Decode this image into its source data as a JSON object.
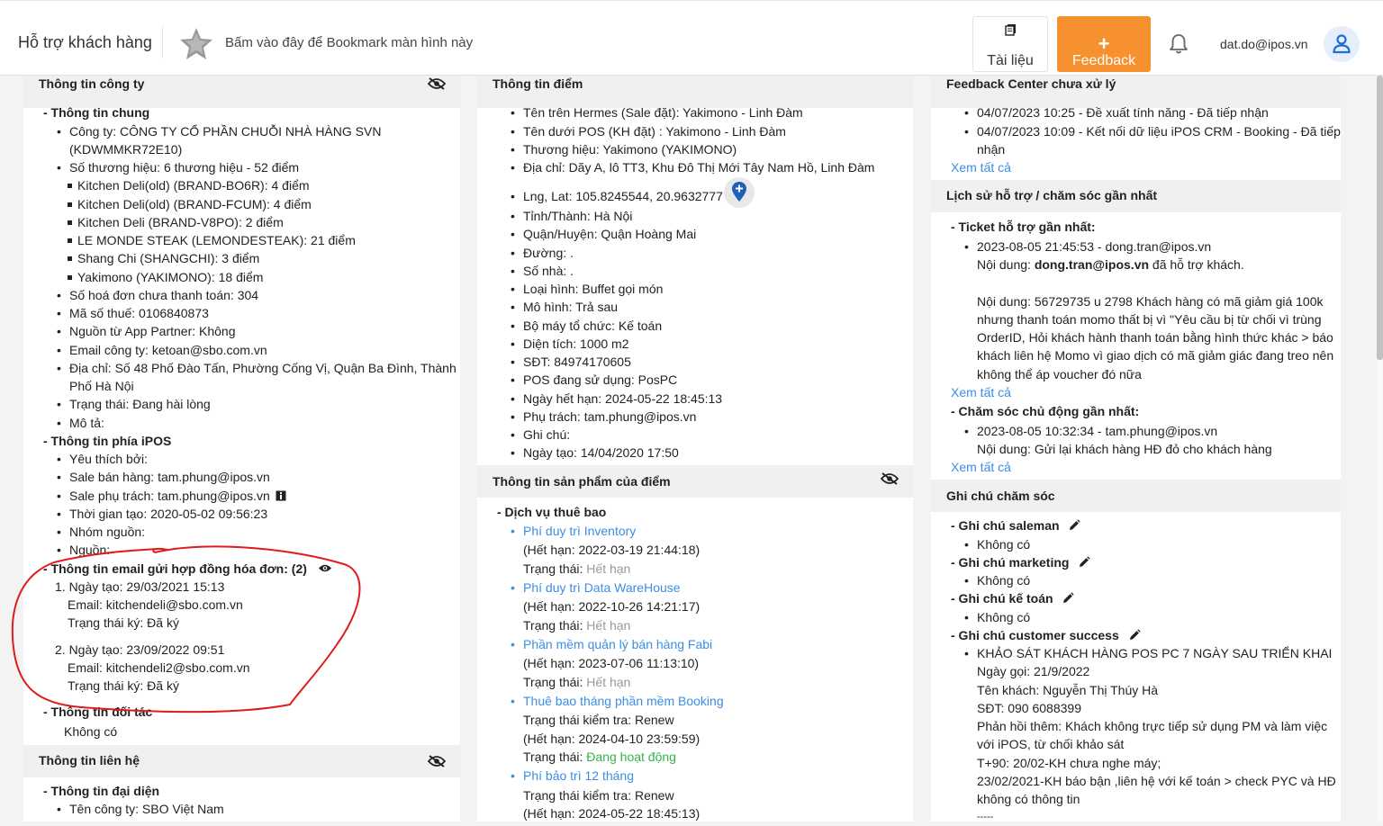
{
  "header": {
    "app_title": "Hỗ trợ khách hàng",
    "bookmark_hint": "Bấm vào đây để Bookmark màn hình này",
    "docs_label": "Tài liệu",
    "feedback_plus": "+",
    "feedback_label": "Feedback",
    "user_email": "dat.do@ipos.vn"
  },
  "company": {
    "title": "Thông tin công ty",
    "general_title": "- Thông tin chung",
    "company_line1": "Công ty: CÔNG TY CỔ PHẦN CHUỖI NHÀ HÀNG SVN",
    "company_line2": "(KDWMMKR72E10)",
    "brand_count": "Số thương hiệu: 6 thương hiệu - 52 điểm",
    "brands": [
      "Kitchen Deli(old) (BRAND-BO6R): 4 điểm",
      "Kitchen Deli(old) (BRAND-FCUM): 4 điểm",
      "Kitchen Deli (BRAND-V8PO): 2 điểm",
      "LE MONDE STEAK (LEMONDESTEAK): 21 điểm",
      "Shang Chi (SHANGCHI): 3 điểm",
      "Yakimono (YAKIMONO): 18 điểm"
    ],
    "unpaid": "Số hoá đơn chưa thanh toán: 304",
    "tax": "Mã số thuế: 0106840873",
    "partner": "Nguồn từ App Partner: Không",
    "email": "Email công ty: ketoan@sbo.com.vn",
    "address1": "Địa chỉ: Số 48 Phố Đào Tấn, Phường Cống Vị, Quận Ba Đình, Thành",
    "address2": "Phố Hà Nội",
    "status": "Trạng thái: Đang hài lòng",
    "desc": "Mô tả:",
    "ipos_title": "- Thông tin phía iPOS",
    "liked_by": "Yêu thích bởi:",
    "sale": "Sale bán hàng: tam.phung@ipos.vn",
    "sale_support": "Sale phụ trách: tam.phung@ipos.vn",
    "created": "Thời gian tạo: 2020-05-02 09:56:23",
    "source_group": "Nhóm nguồn:",
    "source": "Nguồn:",
    "email_contract_title": "- Thông tin email gửi hợp đồng hóa đơn: (2)",
    "contracts": [
      {
        "created": "1. Ngày tạo: 29/03/2021 15:13",
        "email": "Email: kitchendeli@sbo.com.vn",
        "status": "Trạng thái ký: Đã ký"
      },
      {
        "created": "2. Ngày tạo: 23/09/2022 09:51",
        "email": "Email: kitchendeli2@sbo.com.vn",
        "status": "Trạng thái ký: Đã ký"
      }
    ],
    "partner_title": "- Thông tin đối tác",
    "partner_value": "Không có"
  },
  "contact": {
    "title": "Thông tin liên hệ",
    "rep_title": "- Thông tin đại diện",
    "rep_company": "Tên công ty: SBO Việt Nam"
  },
  "point": {
    "title": "Thông tin điểm",
    "lines": [
      "Tên trên Hermes (Sale đặt): Yakimono - Linh Đàm",
      "Tên dưới POS (KH đặt) : Yakimono - Linh Đàm",
      "Thương hiệu: Yakimono (YAKIMONO)",
      "Địa chỉ: Dãy A, lô TT3, Khu Đô Thị Mới Tây Nam Hồ, Linh Đàm"
    ],
    "latlng": "Lng, Lat: 105.8245544, 20.9632777",
    "lines2": [
      "Tỉnh/Thành: Hà Nội",
      "Quận/Huyện: Quận Hoàng Mai",
      "Đường: .",
      "Số nhà: .",
      "Loại hình: Buffet gọi món",
      "Mô hình: Trả sau",
      "Bộ máy tổ chức: Kế toán",
      "Diện tích: 1000 m2",
      "SĐT: 84974170605",
      "POS đang sử dụng: PosPC",
      "Ngày hết hạn: 2024-05-22 18:45:13",
      "Phụ trách: tam.phung@ipos.vn",
      "Ghi chú:",
      "Ngày tạo: 14/04/2020 17:50"
    ]
  },
  "products": {
    "title": "Thông tin sản phẩm của điểm",
    "sub_title": "- Dịch vụ thuê bao",
    "status_prefix": "Trạng thái: ",
    "check_prefix": "Trạng thái kiểm tra: ",
    "items": [
      {
        "name": "Phí duy trì Inventory",
        "expiry": "(Hết hạn: 2022-03-19 21:44:18)",
        "status": "Hết hạn"
      },
      {
        "name": "Phí duy trì Data WareHouse",
        "expiry": "(Hết hạn: 2022-10-26 14:21:17)",
        "status": "Hết hạn"
      },
      {
        "name": "Phần mềm quản lý bán hàng Fabi",
        "expiry": "(Hết hạn: 2023-07-06 11:13:10)",
        "status": "Hết hạn"
      },
      {
        "name": "Thuê bao tháng phần mềm Booking",
        "check": "Renew",
        "expiry": "(Hết hạn: 2024-04-10 23:59:59)",
        "status": "Đang hoạt động"
      },
      {
        "name": "Phí bảo trì 12 tháng",
        "check": "Renew",
        "expiry": "(Hết hạn: 2024-05-22 18:45:13)"
      }
    ]
  },
  "feedback_center": {
    "title": "Feedback Center chưa xử lý",
    "item1": "04/07/2023 10:25 - Đề xuất tính năng - Đã tiếp nhận",
    "item2_line1": "04/07/2023 10:09 - Kết nối dữ liệu iPOS CRM - Booking - Đã tiếp",
    "item2_line2": "nhận",
    "see_all": "Xem tất cả"
  },
  "history": {
    "title": "Lịch sử hỗ trợ / chăm sóc gần nhất",
    "ticket_title": "- Ticket hỗ trợ gần nhất:",
    "ticket_time": "2023-08-05 21:45:53 - dong.tran@ipos.vn",
    "ticket_content_prefix": "Nội dung: ",
    "ticket_content_bold": "dong.tran@ipos.vn",
    "ticket_content_suffix": " đã hỗ trợ khách.",
    "ticket_detail": [
      "Nội dung: 56729735 u 2798 Khách hàng có mã giảm giá 100k",
      "nhưng thanh toán momo thất bị vì \"Yêu cầu bị từ chối vì trùng",
      "OrderID, Hỏi khách hành thanh toán bằng hình thức khác > báo",
      "khách liên hệ Momo vì giao dịch có mã giảm giác đang treo nên",
      "không thể áp voucher đó nữa"
    ],
    "see_all": "Xem tất cả",
    "care_title": "- Chăm sóc chủ động gần nhất:",
    "care_time": "2023-08-05 10:32:34 - tam.phung@ipos.vn",
    "care_content": "Nội dung: Gửi lại khách hàng HĐ đỏ cho khách hàng"
  },
  "notes": {
    "title": "Ghi chú chăm sóc",
    "saleman_title": "- Ghi chú saleman",
    "marketing_title": "- Ghi chú marketing",
    "accounting_title": "- Ghi chú kế toán",
    "cs_title": "- Ghi chú customer success",
    "none": "Không có",
    "cs_lines": [
      "KHẢO SÁT KHÁCH HÀNG POS PC 7 NGÀY SAU TRIỂN KHAI",
      "Ngày gọi: 21/9/2022",
      "Tên khách: Nguyễn Thị Thúy Hà",
      "SĐT: 090 6088399",
      "Phản hồi thêm: Khách không trực tiếp sử dụng PM và làm việc",
      "với iPOS, từ chối khảo sát",
      "T+90: 20/02-KH chưa nghe máy;",
      "23/02/2021-KH báo bận ,liên hệ với kế toán > check PYC và HĐ",
      "không có thông tin",
      "-----"
    ]
  },
  "colors": {
    "accent": "#f7902f",
    "link": "#3a8ee6",
    "expired": "#999999",
    "active": "#33b44a",
    "annotation": "#e11b1b"
  }
}
